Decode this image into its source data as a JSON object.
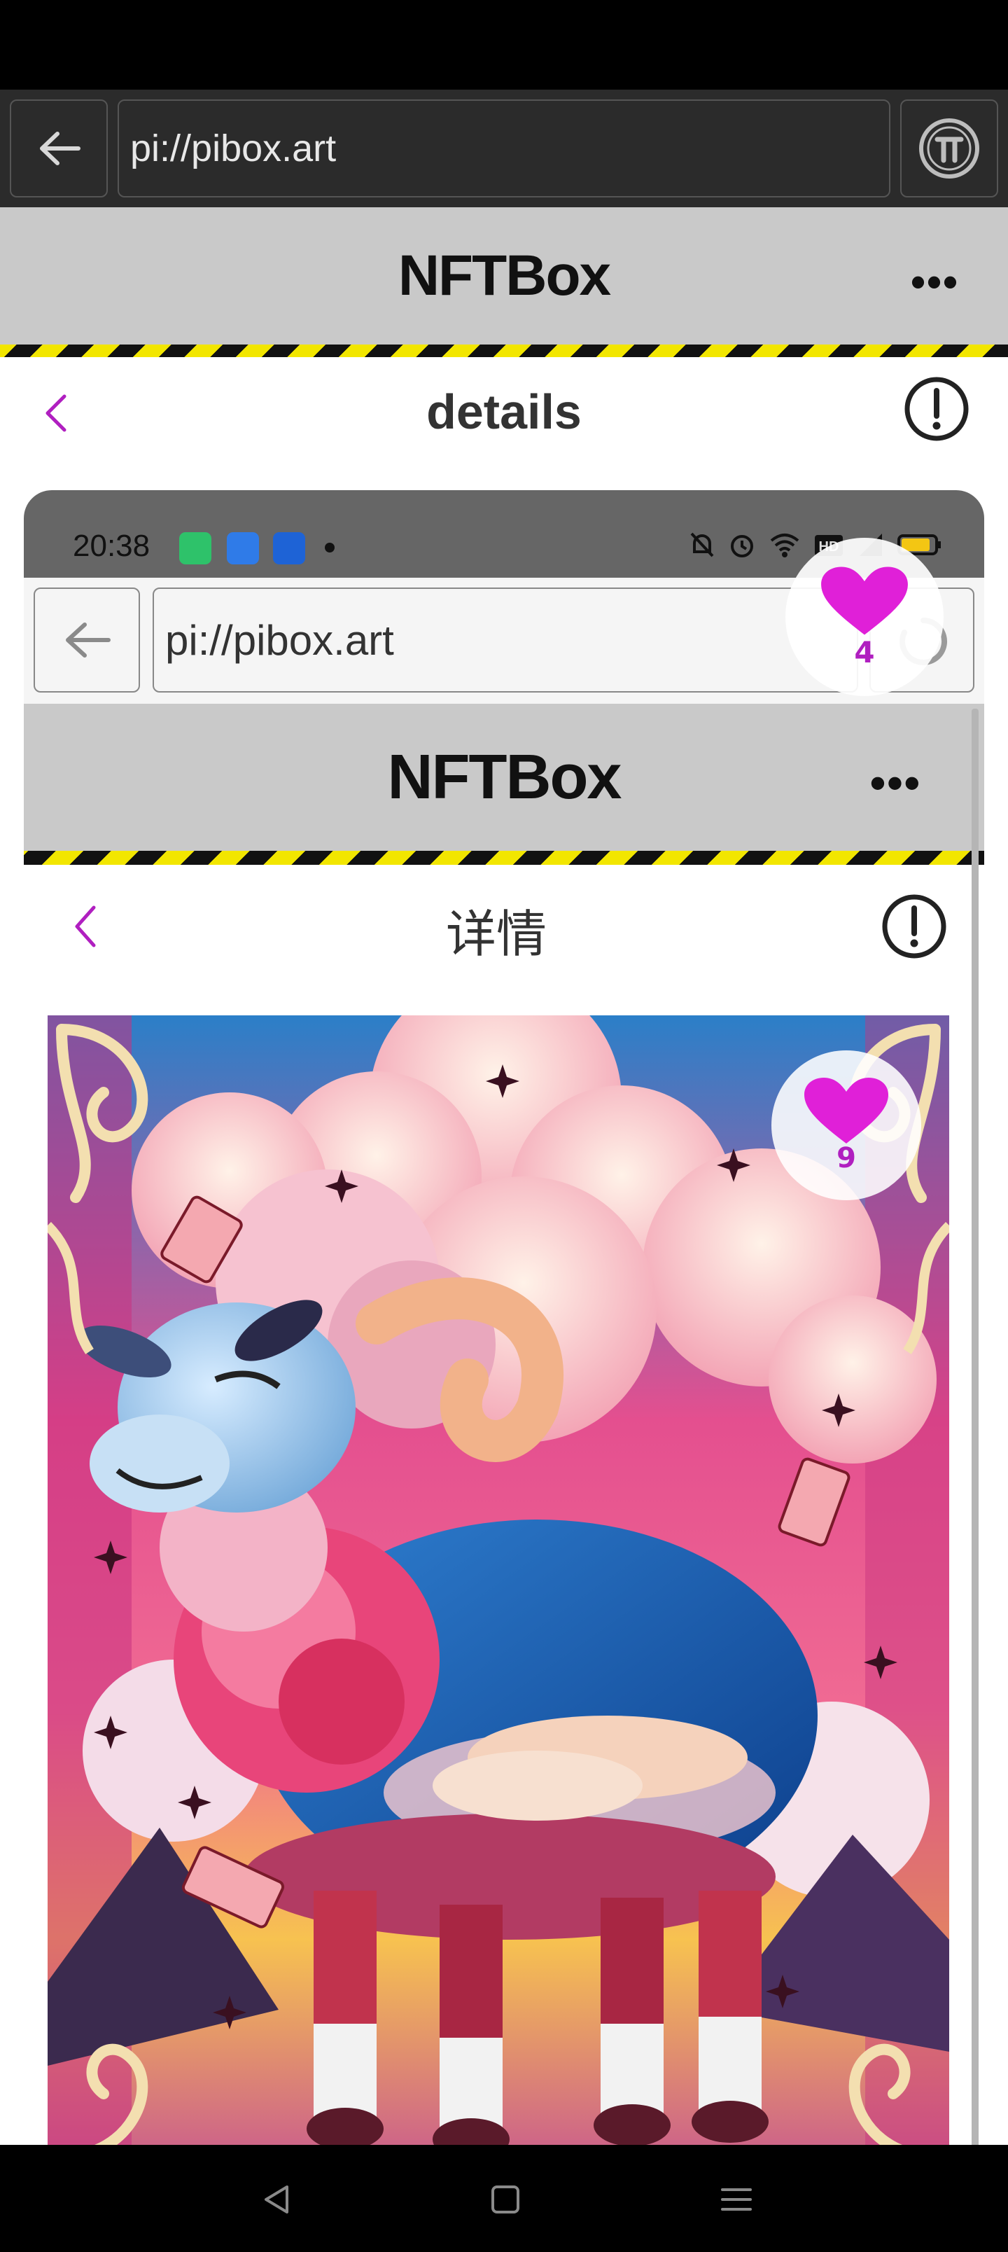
{
  "browser": {
    "url": "pi://pibox.art",
    "back_icon": "arrow-left-icon",
    "pi_icon": "pi-logo-icon"
  },
  "app": {
    "title": "NFTBox",
    "more_label": "•••"
  },
  "detail_header": {
    "title": "details",
    "back_icon": "chevron-left-icon",
    "info_icon": "exclamation-circle-icon"
  },
  "likes_outer": {
    "count": "4",
    "icon": "heart-icon"
  },
  "embedded_screenshot": {
    "status_time": "20:38",
    "url": "pi://pibox.art",
    "app_title": "NFTBox",
    "more_label": "•••",
    "detail_title": "详情",
    "likes": {
      "count": "9",
      "icon": "heart-icon"
    },
    "artwork_subject": "sheep-artwork-image"
  },
  "nav": {
    "back_icon": "triangle-back-icon",
    "home_icon": "square-home-icon",
    "menu_icon": "menu-lines-icon"
  },
  "colors": {
    "accent": "#b01fc0",
    "heart": "#e020d8",
    "header_bg": "#c9c9c9",
    "hazard_yellow": "#f2e600"
  }
}
